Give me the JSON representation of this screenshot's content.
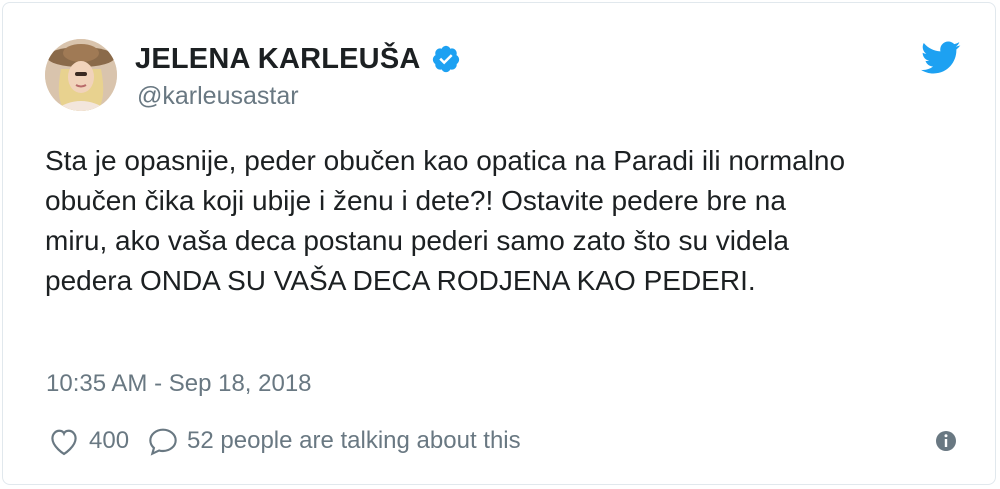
{
  "author": {
    "name": "JELENA KARLEUŠA",
    "handle": "@karleusastar",
    "verified": true,
    "avatar_icon": "avatar-photo"
  },
  "tweet": {
    "lines": [
      "Sta je opasnije, peder obučen kao opatica na Paradi ili normalno",
      "obučen čika koji ubije i ženu i dete?! Ostavite pedere bre na",
      "miru, ako vaša deca postanu pederi samo zato što su videla",
      "pedera ONDA SU VAŠA DECA RODJENA KAO PEDERI."
    ],
    "timestamp": "10:35 AM - Sep 18, 2018"
  },
  "actions": {
    "likes": "400",
    "conversation": "52 people are talking about this"
  },
  "colors": {
    "twitter_blue": "#1da1f2",
    "text": "#1c2022",
    "muted": "#697882",
    "border": "#e1e8ed"
  },
  "icons": {
    "brand": "twitter-bird-icon",
    "verified": "verified-badge-icon",
    "like": "heart-icon",
    "reply": "speech-bubble-icon",
    "info": "info-icon"
  }
}
